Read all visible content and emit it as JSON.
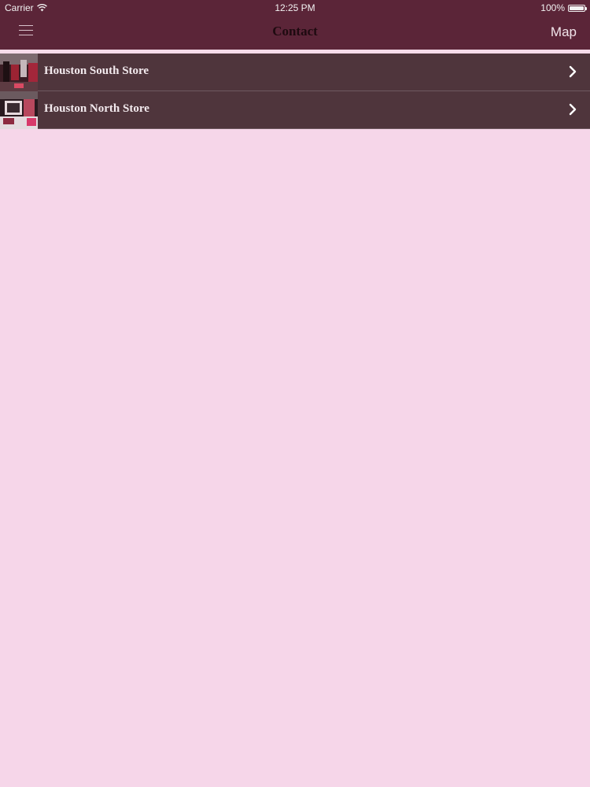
{
  "status_bar": {
    "carrier": "Carrier",
    "time": "12:25 PM",
    "battery": "100%",
    "battery_level": 1.0
  },
  "nav": {
    "title": "Contact",
    "right_button": "Map",
    "left_icon": "hamburger-menu-icon"
  },
  "stores": [
    {
      "name": "Houston South Store",
      "thumb_icon": "store-photo"
    },
    {
      "name": "Houston North Store",
      "thumb_icon": "store-photo"
    }
  ],
  "colors": {
    "nav_bg": "#5b2538",
    "row_bg": "#4f353c",
    "page_bg": "#f6d6e9"
  }
}
